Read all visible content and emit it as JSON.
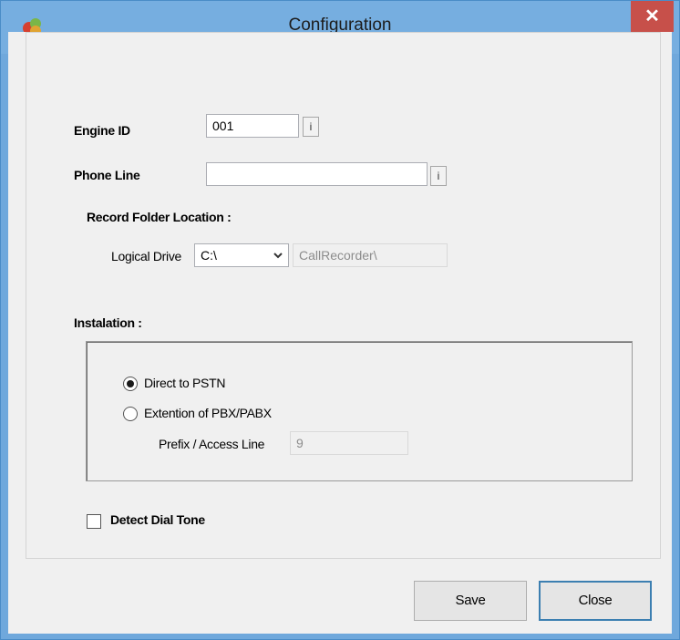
{
  "window": {
    "title": "Configuration",
    "close_glyph": "✕",
    "icon": "app-logo-icon"
  },
  "form": {
    "engine_id": {
      "label": "Engine ID",
      "value": "001",
      "info": "i"
    },
    "phone_line": {
      "label": "Phone Line",
      "value": "",
      "info": "i"
    },
    "record_folder": {
      "heading": "Record Folder Location :",
      "drive_label": "Logical Drive",
      "drive_value": "C:\\",
      "folder_value": "CallRecorder\\"
    },
    "installation": {
      "heading": "Instalation :",
      "option_direct": "Direct to PSTN",
      "option_pbx": "Extention of PBX/PABX",
      "selected": "direct",
      "prefix_label": "Prefix / Access Line",
      "prefix_value": "9"
    },
    "detect_dial_tone": {
      "label": "Detect Dial Tone",
      "checked": false
    }
  },
  "buttons": {
    "save": "Save",
    "close": "Close"
  },
  "colors": {
    "titlebar": "#76aee0",
    "close_button": "#c7504a",
    "default_button_border": "#3c7fb1"
  }
}
